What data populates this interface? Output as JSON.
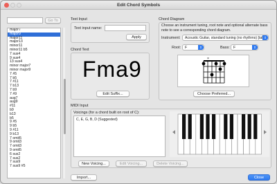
{
  "window": {
    "title": "Edit Chord Symbols"
  },
  "search": {
    "button_label": "Go To",
    "value": ""
  },
  "chord_list": {
    "items": [
      "major7",
      "major9",
      "major11",
      "major13",
      "minor11",
      "minor11 b5",
      "7 sus4",
      "9 sus4",
      "13 sus4",
      "minor major7",
      "minor major9",
      "7 #5",
      "7 b5",
      "7 #11",
      "7 b13",
      "7 b9",
      "7 #9",
      "aug7",
      "aug9",
      "#11",
      "b9",
      "b13",
      "b5",
      "9 #5",
      "9 b5",
      "9 #11",
      "9 b13",
      "7 omit5",
      "9 omit3",
      "7 omit3",
      "9 omit5",
      "6 sus2",
      "7 sus2",
      "7 sus9",
      "7 sus9 #5"
    ],
    "selected_index": 1
  },
  "text_input": {
    "section_label": "Text Input",
    "input_name_label": "Text input name:",
    "input_name_value": "",
    "apply_label": "Apply"
  },
  "chord_text": {
    "section_label": "Chord Text",
    "display": "Fma9",
    "edit_suffix_label": "Edit Suffix..."
  },
  "chord_diagram": {
    "section_label": "Chord Diagram",
    "description": "Choose an instrument tuning, root note and optional alternate bass note to see a corresponding chord diagram.",
    "instrument_label": "Instrument:",
    "instrument_value": "Acoustic Guitar, standard tuning (no rhythms) [tab]",
    "root_label": "Root:",
    "root_value": "F",
    "bass_label": "Bass:",
    "bass_value": "F",
    "choose_preferred_label": "Choose Preferred..."
  },
  "midi_input": {
    "section_label": "MIDI Input",
    "voicings_label": "Voicings (for a chord built on root of C):",
    "voicings": [
      "C, E, G, B, D (Suggested)"
    ],
    "new_voicing_label": "New Voicing...",
    "edit_voicing_label": "Edit Voicing...",
    "delete_voicing_label": "Delete Voicing..."
  },
  "footer": {
    "import_label": "Import...",
    "close_label": "Close"
  },
  "colors": {
    "accent": "#2f7af0",
    "selected": "#2f6fd8",
    "close_red": "#ec5f57"
  }
}
